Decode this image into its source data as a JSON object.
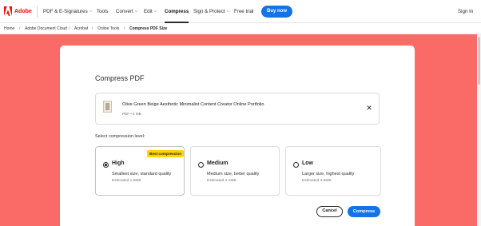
{
  "header": {
    "brand": "Adobe",
    "nav": [
      {
        "label": "PDF & E-Signatures",
        "dropdown": true
      },
      {
        "label": "Tools",
        "dropdown": false
      },
      {
        "label": "Convert",
        "dropdown": true
      },
      {
        "label": "Edit",
        "dropdown": true
      },
      {
        "label": "Compress",
        "dropdown": false,
        "active": true
      },
      {
        "label": "Sign & Protect",
        "dropdown": true
      },
      {
        "label": "Free trial",
        "dropdown": false
      }
    ],
    "buy_now": "Buy now",
    "sign_in": "Sign In"
  },
  "breadcrumb": [
    "Home",
    "Adobe Document Cloud",
    "Acrobat",
    "Online Tools",
    "Compress PDF Size"
  ],
  "dialog": {
    "title": "Compress PDF",
    "file": {
      "name": "Olive Green Beige Aesthetic Minimalist Content Creator Online Portfolio",
      "meta": "PDF • 4 MB"
    },
    "level_label": "Select compression level:",
    "options": [
      {
        "title": "High",
        "desc": "Smallest size, standard quality",
        "estimate": "Estimated 1.5MB",
        "badge": "Best compression",
        "selected": true
      },
      {
        "title": "Medium",
        "desc": "Medium size, better quality",
        "estimate": "Estimated 2.1MB",
        "selected": false
      },
      {
        "title": "Low",
        "desc": "Larger size, highest quality",
        "estimate": "Estimated 3.6MB",
        "selected": false
      }
    ],
    "cancel": "Cancel",
    "compress": "Compress"
  },
  "colors": {
    "background": "#fa6a67",
    "accent": "#1473e6",
    "brand": "#eb1000",
    "badge": "#ffd400"
  }
}
